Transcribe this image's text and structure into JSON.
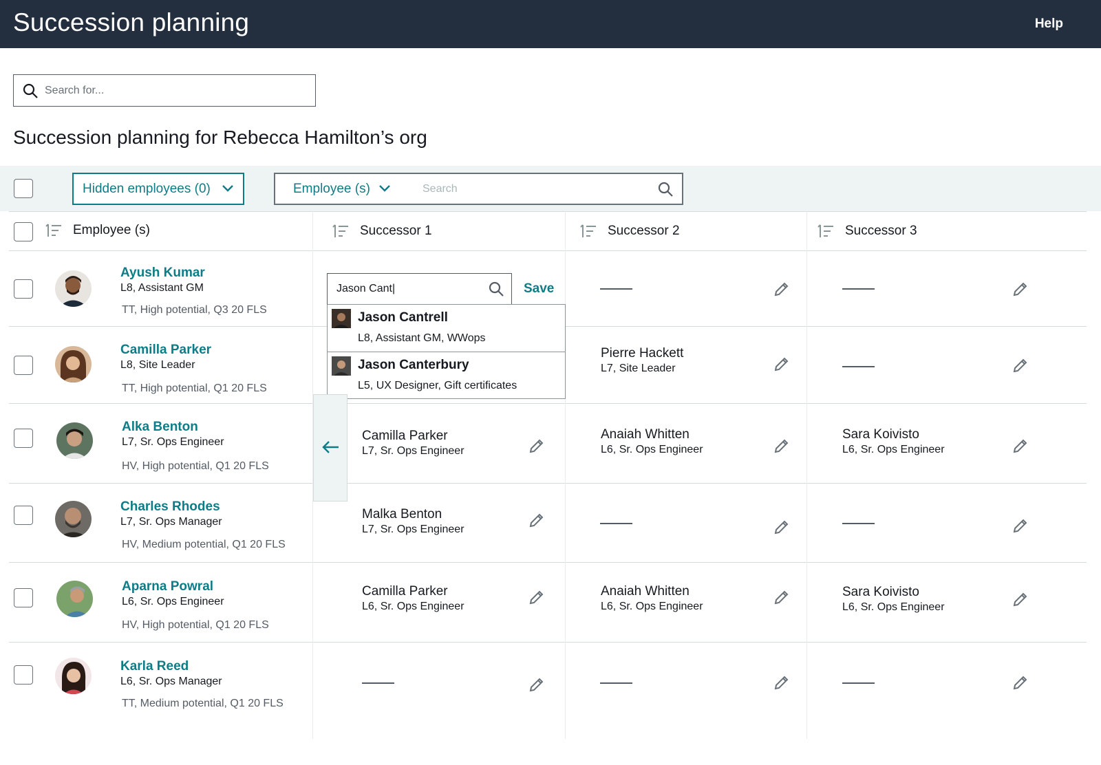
{
  "header": {
    "title": "Succession planning",
    "help_label": "Help"
  },
  "search": {
    "placeholder": "Search for..."
  },
  "page": {
    "heading": "Succession planning for Rebecca Hamilton’s org"
  },
  "filters": {
    "hidden_employees_label": "Hidden employees (0)",
    "employee_filter_label": "Employee (s)",
    "employee_search_placeholder": "Search"
  },
  "columns": {
    "employee": "Employee (s)",
    "successor1": "Successor 1",
    "successor2": "Successor 2",
    "successor3": "Successor 3"
  },
  "active_edit": {
    "input_value": "Jason Cant|",
    "save_label": "Save"
  },
  "suggestions": [
    {
      "name": "Jason Cantrell",
      "detail": "L8, Assistant GM, WWops"
    },
    {
      "name": "Jason Canterbury",
      "detail": "L5, UX Designer, Gift certificates"
    }
  ],
  "rows": [
    {
      "name": "Ayush Kumar",
      "role": "L8, Assistant GM",
      "tags": "TT, High potential, Q3 20 FLS",
      "successors": [
        null,
        null,
        null
      ]
    },
    {
      "name": "Camilla Parker",
      "role": "L8, Site Leader",
      "tags": "TT, High potential, Q1 20 FLS",
      "successors": [
        null,
        {
          "name": "Pierre Hackett",
          "role": "L7, Site Leader"
        },
        null
      ]
    },
    {
      "name": "Alka Benton",
      "role": "L7, Sr. Ops Engineer",
      "tags": "HV, High potential, Q1 20 FLS",
      "successors": [
        {
          "name": "Camilla Parker",
          "role": "L7, Sr. Ops Engineer"
        },
        {
          "name": "Anaiah Whitten",
          "role": "L6, Sr. Ops Engineer"
        },
        {
          "name": "Sara Koivisto",
          "role": "L6, Sr. Ops Engineer"
        }
      ]
    },
    {
      "name": "Charles Rhodes",
      "role": "L7, Sr. Ops Manager",
      "tags": "HV, Medium potential, Q1 20 FLS",
      "successors": [
        {
          "name": "Malka Benton",
          "role": "L7, Sr. Ops Engineer"
        },
        null,
        null
      ]
    },
    {
      "name": "Aparna Powral",
      "role": "L6, Sr. Ops Engineer",
      "tags": "HV, High potential, Q1 20 FLS",
      "successors": [
        {
          "name": "Camilla Parker",
          "role": "L6, Sr. Ops Engineer"
        },
        {
          "name": "Anaiah Whitten",
          "role": "L6, Sr. Ops Engineer"
        },
        {
          "name": "Sara Koivisto",
          "role": "L6, Sr. Ops Engineer"
        }
      ]
    },
    {
      "name": "Karla Reed",
      "role": "L6, Sr. Ops Manager",
      "tags": "TT, Medium potential, Q1 20 FLS",
      "successors": [
        null,
        null,
        null
      ]
    }
  ],
  "colors": {
    "header_bg": "#232f3e",
    "link": "#0e7c86",
    "filterbar_bg": "#eef3f4"
  },
  "icons": [
    "search-icon",
    "chevron-down-icon",
    "sort-icon",
    "pencil-icon",
    "arrow-left-icon",
    "avatar"
  ]
}
